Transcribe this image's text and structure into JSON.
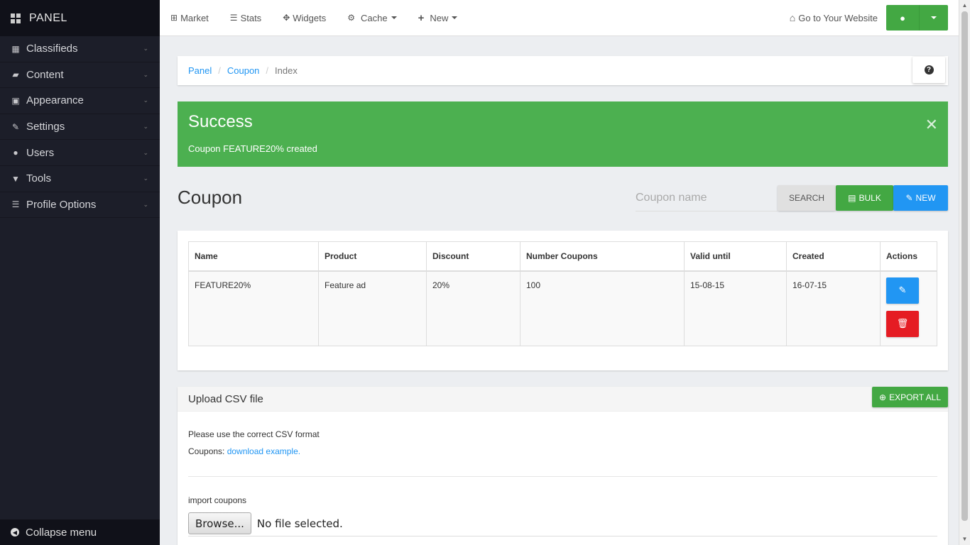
{
  "sidebar": {
    "brand": "PANEL",
    "items": [
      {
        "label": "Classifieds",
        "icon": "grid-icon"
      },
      {
        "label": "Content",
        "icon": "folder-open-icon"
      },
      {
        "label": "Appearance",
        "icon": "image-icon"
      },
      {
        "label": "Settings",
        "icon": "wrench-icon"
      },
      {
        "label": "Users",
        "icon": "user-icon"
      },
      {
        "label": "Tools",
        "icon": "filter-icon"
      },
      {
        "label": "Profile Options",
        "icon": "list-icon"
      }
    ],
    "collapse_label": "Collapse menu"
  },
  "topbar": {
    "items": [
      {
        "label": "Market",
        "icon": "sitemap-icon"
      },
      {
        "label": "Stats",
        "icon": "list-icon"
      },
      {
        "label": "Widgets",
        "icon": "move-icon"
      },
      {
        "label": "Cache",
        "icon": "gear-icon"
      },
      {
        "label": "New",
        "icon": "plus-icon"
      }
    ],
    "website_link": "Go to Your Website"
  },
  "breadcrumb": {
    "items": [
      "Panel",
      "Coupon"
    ],
    "current": "Index"
  },
  "alert": {
    "title": "Success",
    "message": "Coupon FEATURE20% created",
    "color": "#4cb050"
  },
  "page": {
    "title": "Coupon",
    "search_placeholder": "Coupon name",
    "search_label": "SEARCH",
    "bulk_label": "BULK",
    "new_label": "NEW"
  },
  "table": {
    "headers": [
      "Name",
      "Product",
      "Discount",
      "Number Coupons",
      "Valid until",
      "Created",
      "Actions"
    ],
    "rows": [
      {
        "name": "FEATURE20%",
        "product": "Feature ad",
        "discount": "20%",
        "number": "100",
        "valid_until": "15-08-15",
        "created": "16-07-15"
      }
    ]
  },
  "upload": {
    "title": "Upload CSV file",
    "export_label": "EXPORT ALL",
    "note": "Please use the correct CSV format",
    "coupons_prefix": "Coupons: ",
    "download_link": "download example.",
    "import_label": "import coupons",
    "browse_label": "Browse...",
    "file_status": "No file selected."
  },
  "colors": {
    "sidebar_bg": "#1c1e29",
    "success": "#43a843",
    "primary": "#2196f3",
    "danger": "#e51c23"
  }
}
